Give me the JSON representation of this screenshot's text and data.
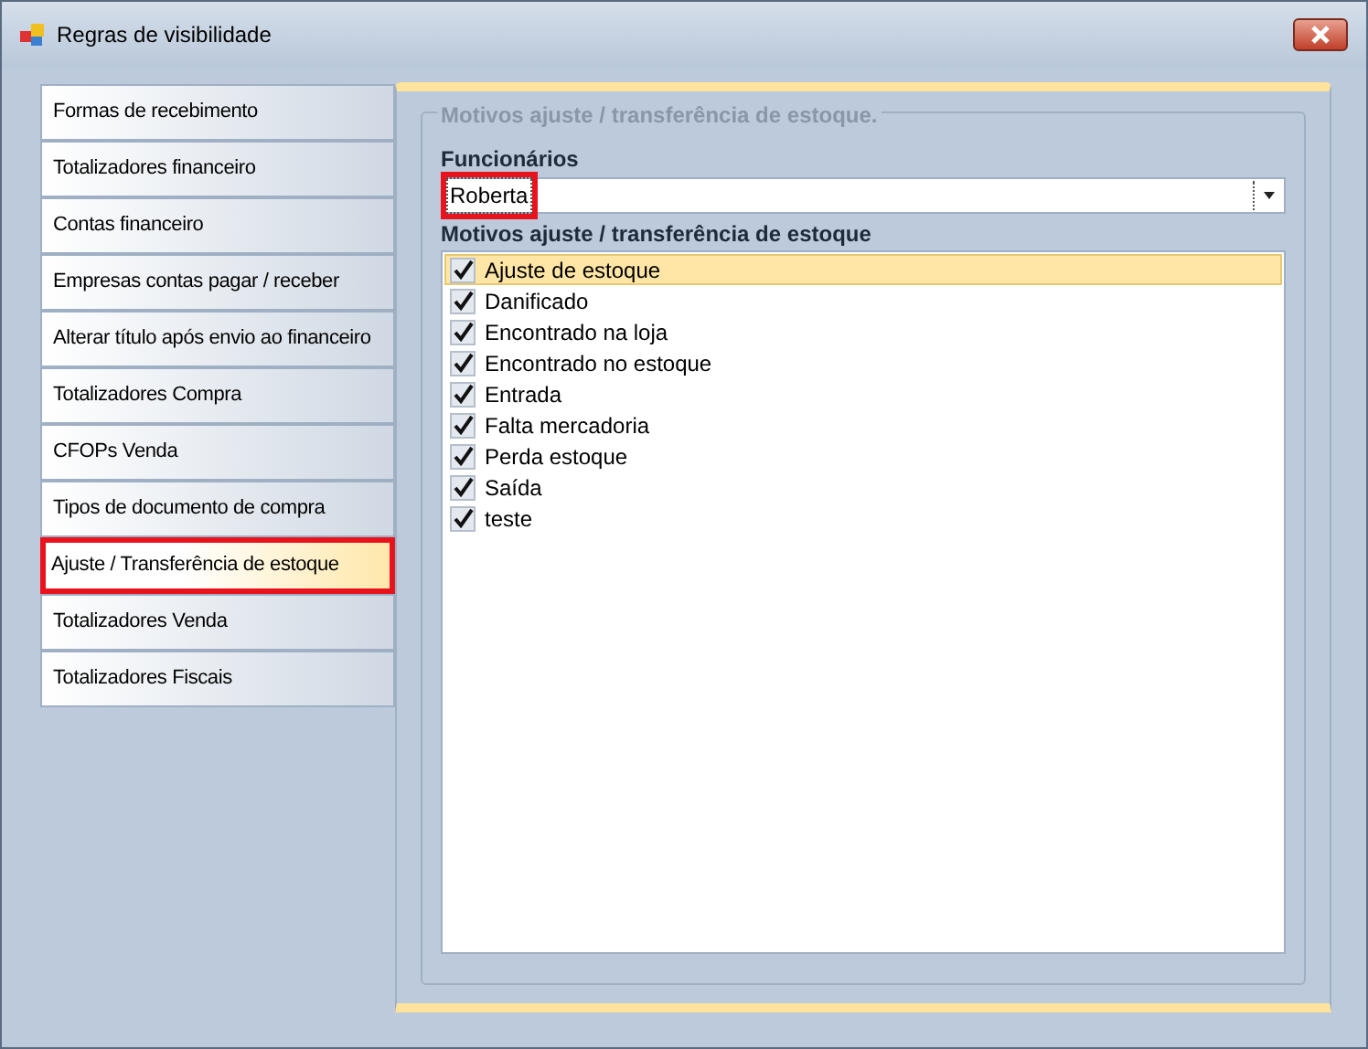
{
  "window": {
    "title": "Regras de visibilidade"
  },
  "tabs": [
    {
      "label": "Formas de recebimento",
      "selected": false,
      "highlighted": false
    },
    {
      "label": "Totalizadores financeiro",
      "selected": false,
      "highlighted": false
    },
    {
      "label": "Contas financeiro",
      "selected": false,
      "highlighted": false
    },
    {
      "label": "Empresas contas pagar / receber",
      "selected": false,
      "highlighted": false
    },
    {
      "label": "Alterar título após envio ao financeiro",
      "selected": false,
      "highlighted": false
    },
    {
      "label": "Totalizadores Compra",
      "selected": false,
      "highlighted": false
    },
    {
      "label": "CFOPs Venda",
      "selected": false,
      "highlighted": false
    },
    {
      "label": "Tipos de documento de compra",
      "selected": false,
      "highlighted": false
    },
    {
      "label": "Ajuste / Transferência de estoque",
      "selected": true,
      "highlighted": true
    },
    {
      "label": "Totalizadores Venda",
      "selected": false,
      "highlighted": false
    },
    {
      "label": "Totalizadores Fiscais",
      "selected": false,
      "highlighted": false
    }
  ],
  "group": {
    "title": "Motivos ajuste / transferência de estoque.",
    "employee": {
      "label": "Funcionários",
      "value": "Roberta",
      "highlighted": true
    },
    "reasons": {
      "label": "Motivos ajuste / transferência de estoque",
      "items": [
        {
          "label": "Ajuste de estoque",
          "checked": true,
          "selected": true
        },
        {
          "label": "Danificado",
          "checked": true,
          "selected": false
        },
        {
          "label": "Encontrado na loja",
          "checked": true,
          "selected": false
        },
        {
          "label": "Encontrado no estoque",
          "checked": true,
          "selected": false
        },
        {
          "label": "Entrada",
          "checked": true,
          "selected": false
        },
        {
          "label": "Falta mercadoria",
          "checked": true,
          "selected": false
        },
        {
          "label": "Perda estoque",
          "checked": true,
          "selected": false
        },
        {
          "label": "Saída",
          "checked": true,
          "selected": false
        },
        {
          "label": "teste",
          "checked": true,
          "selected": false
        }
      ]
    }
  }
}
